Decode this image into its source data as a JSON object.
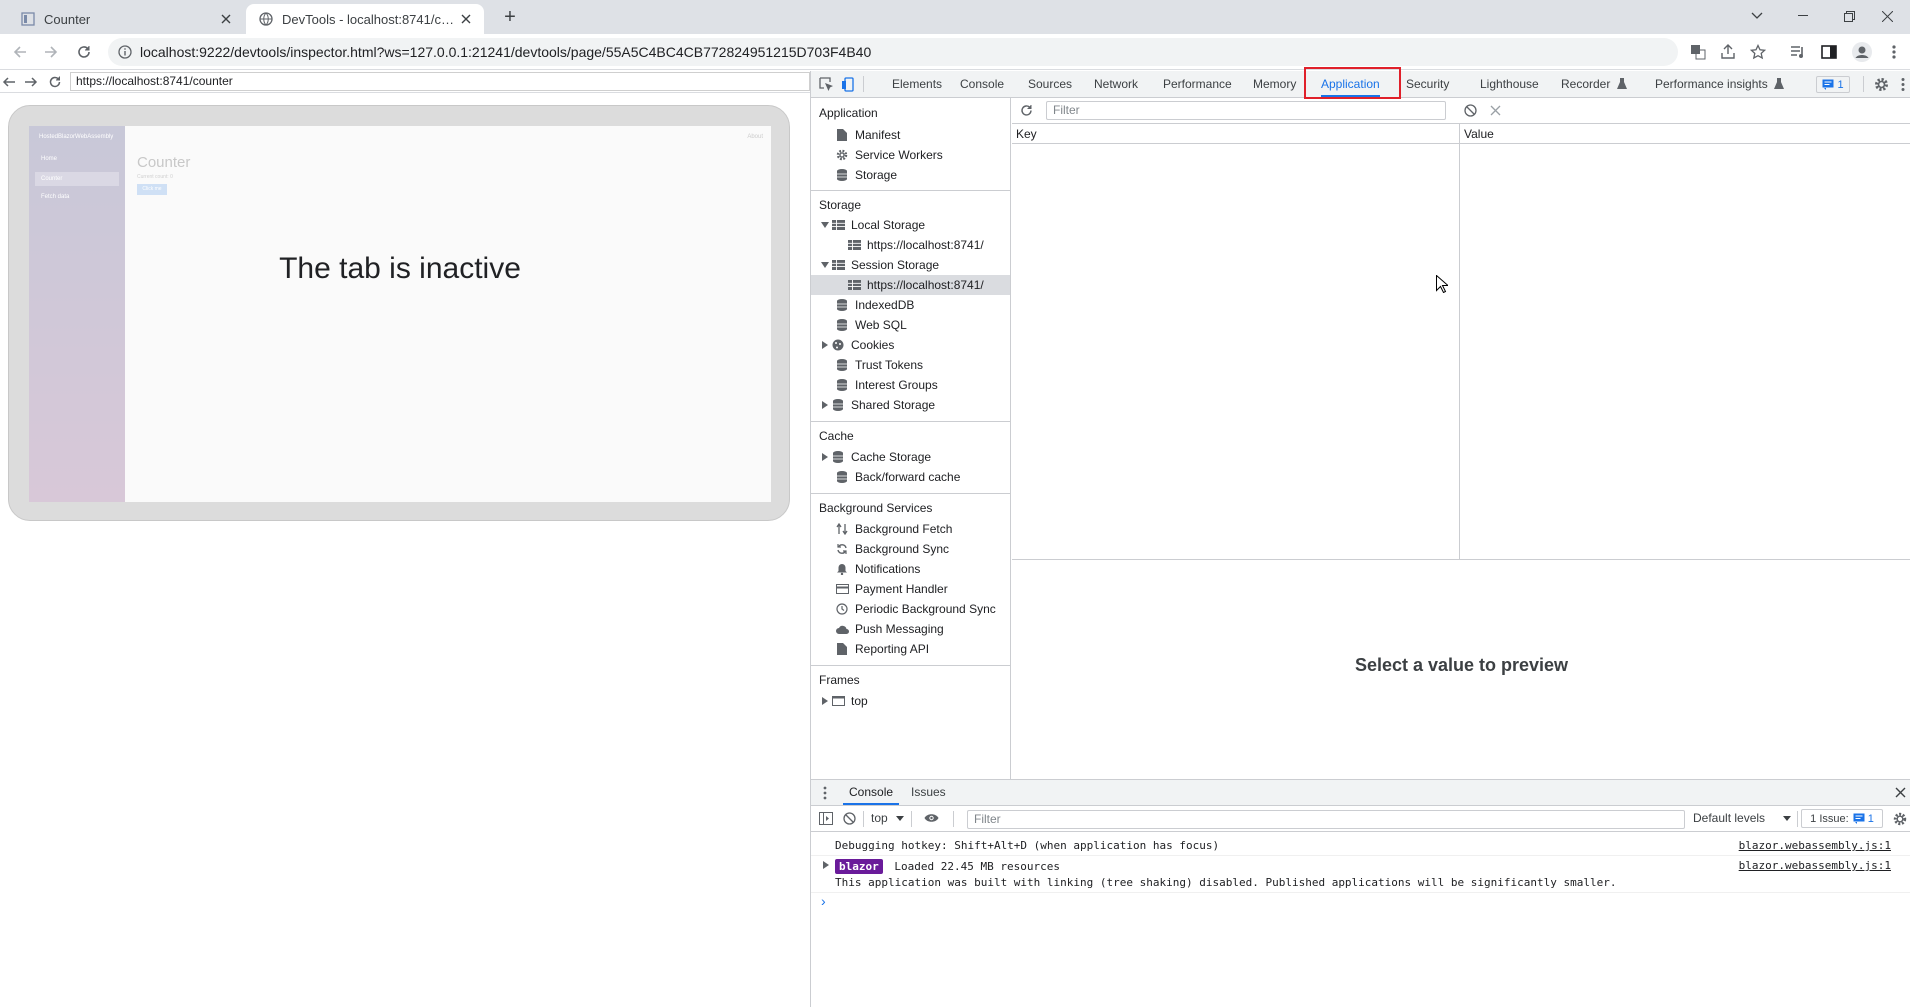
{
  "browser": {
    "tabs": [
      {
        "title": "Counter",
        "active": false
      },
      {
        "title": "DevTools - localhost:8741/counter",
        "active": true
      }
    ],
    "new_tab_label": "+",
    "url": "localhost:9222/devtools/inspector.html?ws=127.0.0.1:21241/devtools/page/55A5C4BC4CB772824951215D703F4B40"
  },
  "screencast": {
    "url": "https://localhost:8741/counter",
    "message": "The tab is inactive",
    "mini_page": {
      "brand": "HostedBlazorWebAssembly",
      "nav": [
        "Home",
        "Counter",
        "Fetch data"
      ],
      "about": "About",
      "heading": "Counter",
      "count_text": "Current count: 0",
      "button": "Click me"
    }
  },
  "devtools": {
    "tabs": [
      "Elements",
      "Console",
      "Sources",
      "Network",
      "Performance",
      "Memory",
      "Application",
      "Security",
      "Lighthouse",
      "Recorder",
      "Performance insights"
    ],
    "selected_tab": "Application",
    "issues_count": "1",
    "sidebar": {
      "application_title": "Application",
      "application_items": [
        "Manifest",
        "Service Workers",
        "Storage"
      ],
      "storage_title": "Storage",
      "local_storage": "Local Storage",
      "local_storage_origin": "https://localhost:8741/",
      "session_storage": "Session Storage",
      "session_storage_origin": "https://localhost:8741/",
      "storage_items": [
        "IndexedDB",
        "Web SQL",
        "Cookies",
        "Trust Tokens",
        "Interest Groups",
        "Shared Storage"
      ],
      "cache_title": "Cache",
      "cache_items": [
        "Cache Storage",
        "Back/forward cache"
      ],
      "background_title": "Background Services",
      "background_items": [
        "Background Fetch",
        "Background Sync",
        "Notifications",
        "Payment Handler",
        "Periodic Background Sync",
        "Push Messaging",
        "Reporting API"
      ],
      "frames_title": "Frames",
      "frames_items": [
        "top"
      ]
    },
    "main": {
      "filter_placeholder": "Filter",
      "col_key": "Key",
      "col_value": "Value",
      "preview_text": "Select a value to preview"
    },
    "drawer": {
      "tabs": [
        "Console",
        "Issues"
      ],
      "context": "top",
      "filter_placeholder": "Filter",
      "levels": "Default levels",
      "issues_label": "1 Issue:",
      "issues_count": "1",
      "messages": [
        {
          "text": "Debugging hotkey: Shift+Alt+D (when application has focus)",
          "source": "blazor.webassembly.js:1"
        },
        {
          "badge": "blazor",
          "text": "Loaded 22.45 MB resources",
          "source": "blazor.webassembly.js:1",
          "detail": "This application was built with linking (tree shaking) disabled. Published applications will be significantly smaller."
        }
      ],
      "prompt": "›"
    }
  },
  "colors": {
    "accent": "#1a73e8",
    "highlight": "#e0202a",
    "badge": "#6a1b9a"
  }
}
